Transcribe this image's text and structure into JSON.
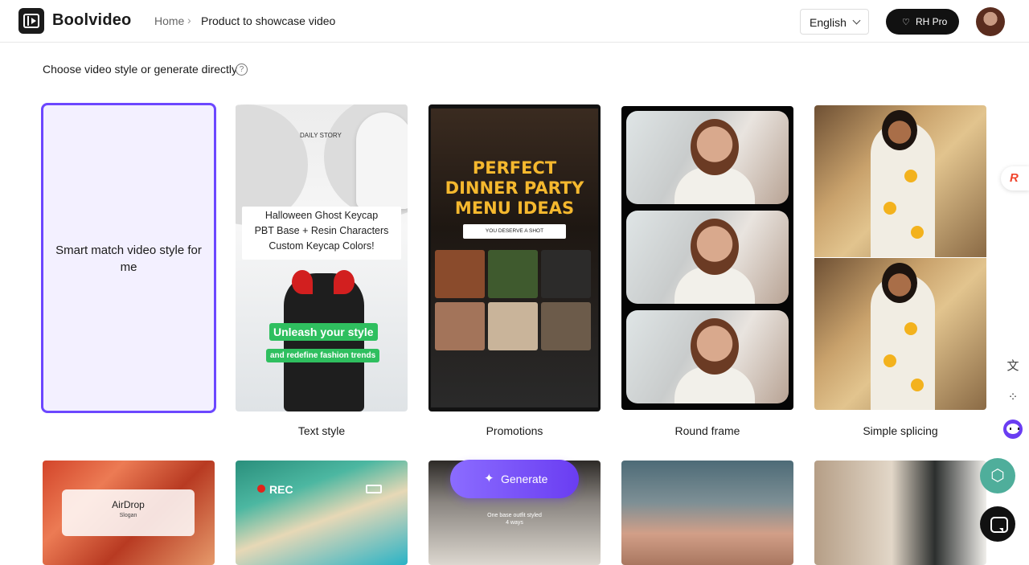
{
  "header": {
    "brand": "Boolvideo",
    "breadcrumb": {
      "home": "Home",
      "separator": "›",
      "current": "Product to showcase video"
    },
    "language": "English",
    "pro_label": "RH Pro",
    "pro_icon": "gem-icon"
  },
  "main": {
    "section_title": "Choose video style or generate directly",
    "help_icon": "?",
    "smart_card": {
      "text": "Smart match video style for me"
    },
    "styles": [
      {
        "label": "Text style",
        "preview": {
          "daily": "DAILY STORY",
          "box_lines": [
            "Halloween Ghost Keycap",
            "PBT Base + Resin Characters",
            "Custom Keycap Colors!"
          ],
          "banner1": "Unleash your style",
          "banner2": "and redefine fashion trends"
        }
      },
      {
        "label": "Promotions",
        "preview": {
          "title_lines": [
            "PERFECT",
            "DINNER PARTY",
            "MENU IDEAS"
          ],
          "pill": "YOU DESERVE A SHOT"
        }
      },
      {
        "label": "Round frame"
      },
      {
        "label": "Simple splicing"
      }
    ],
    "second_row": [
      {
        "t1": "AirDrop",
        "t2": "Slogan"
      },
      {
        "rec": "REC"
      },
      {
        "text_lines": [
          "One base outfit styled",
          "4 ways"
        ]
      },
      {},
      {}
    ],
    "generate_label": "Generate"
  },
  "sidebar": {
    "float_logo": "R",
    "icons": [
      "translate-icon",
      "apps-icon",
      "bot-icon"
    ]
  },
  "colors": {
    "accent": "#6a3df2",
    "selected_border": "#6c47ff",
    "teal": "#4fae9b"
  }
}
